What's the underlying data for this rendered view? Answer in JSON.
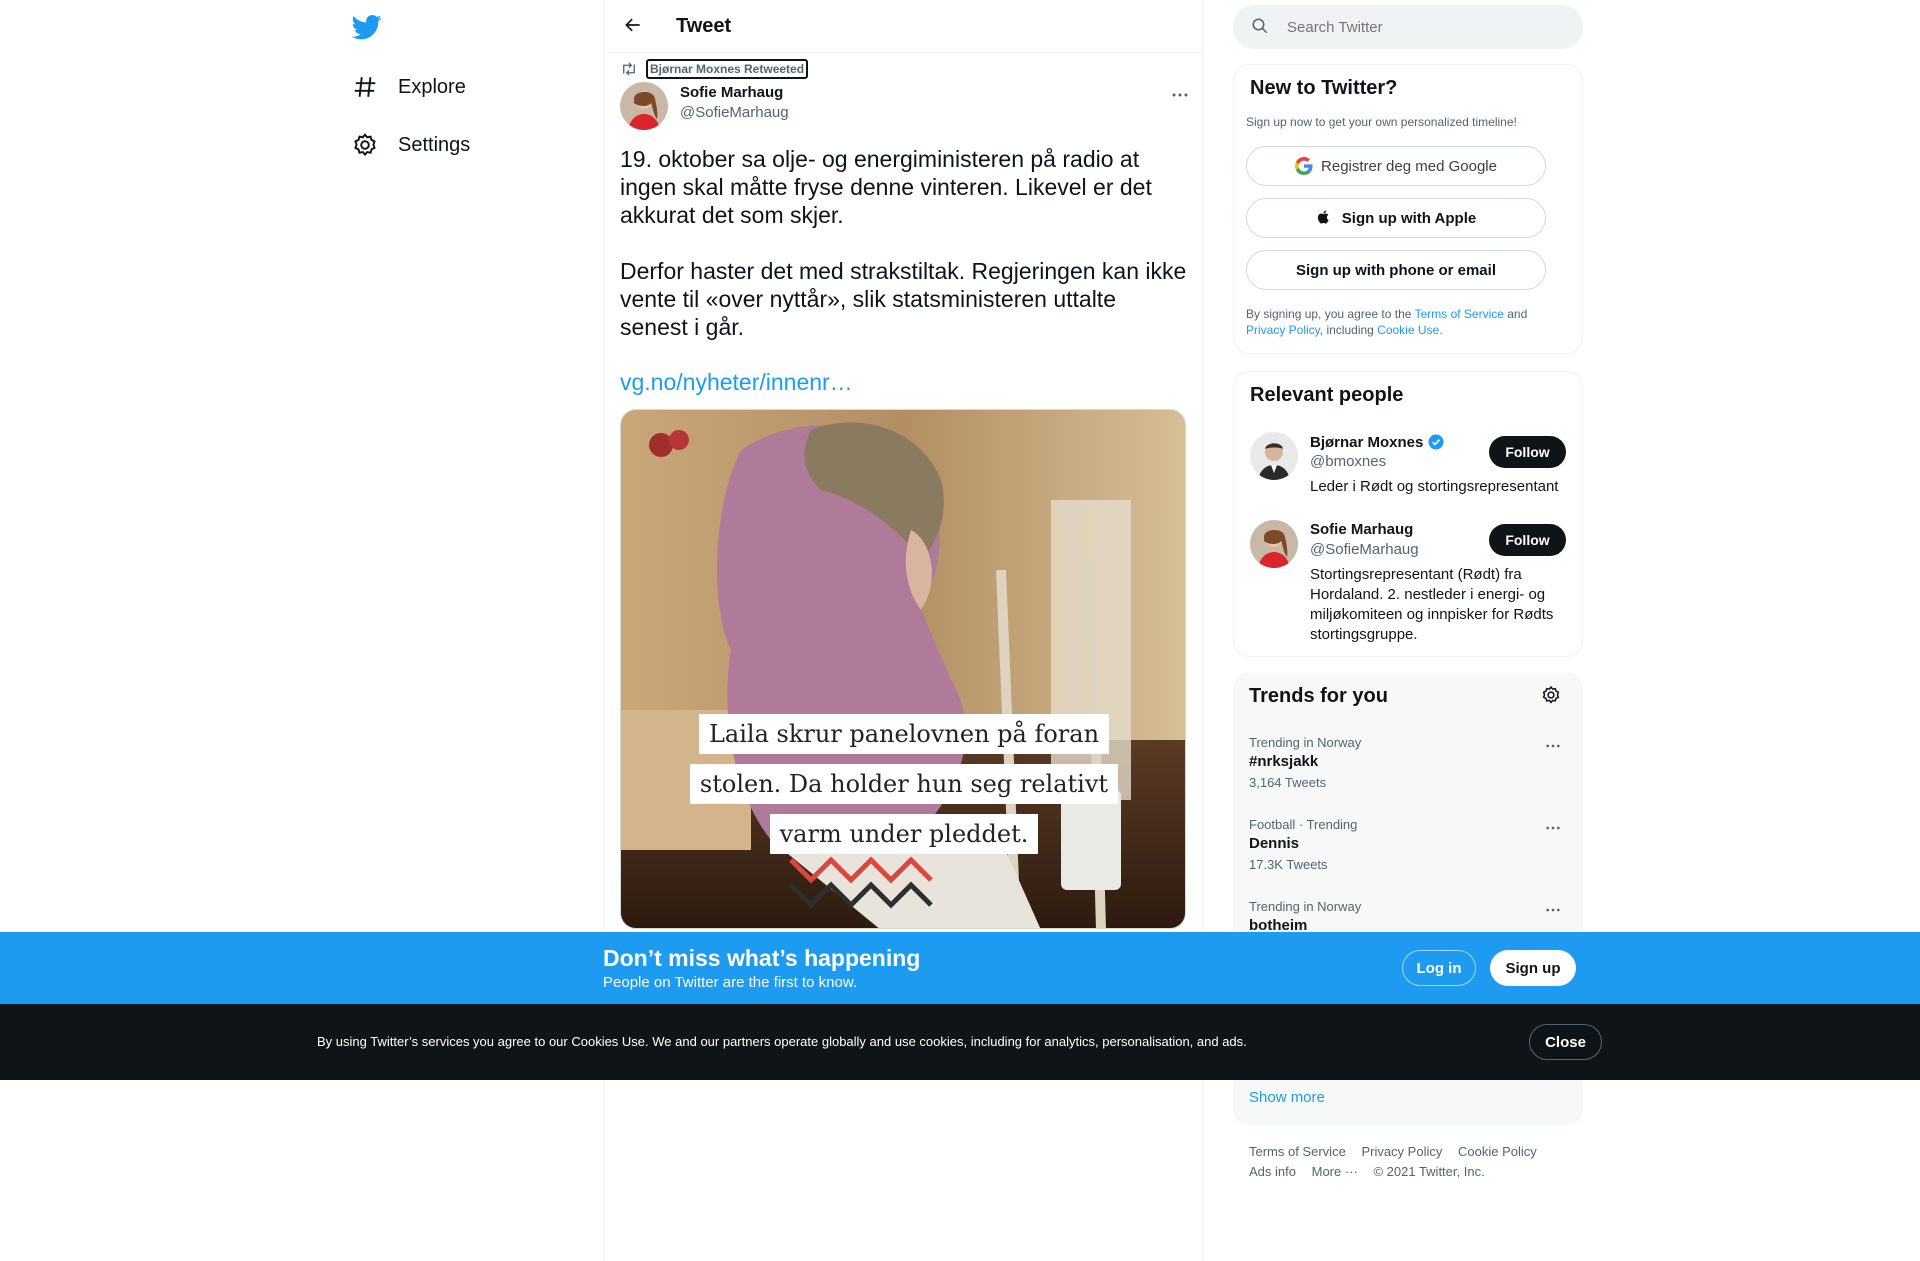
{
  "colors": {
    "accent": "#1d9bf0",
    "text": "#0f1419",
    "muted": "#536471",
    "border": "#eff3f4"
  },
  "nav": {
    "logo_icon": "twitter-bird-icon",
    "items": [
      {
        "label": "Explore",
        "icon": "hashtag-icon"
      },
      {
        "label": "Settings",
        "icon": "gear-icon"
      }
    ]
  },
  "header": {
    "title": "Tweet",
    "back_icon": "arrow-left-icon"
  },
  "tweet": {
    "retweeted_by": "Bjørnar Moxnes Retweeted",
    "author_name": "Sofie Marhaug",
    "author_handle": "@SofieMarhaug",
    "paragraphs": [
      "19. oktober sa olje- og energiministeren på radio at ingen skal måtte fryse denne vinteren. Likevel er det akkurat det som skjer.",
      "Derfor haster det med strakstiltak. Regjeringen kan ikke vente til «over nyttår», slik statsministeren uttalte senest i går."
    ],
    "link": "vg.no/nyheter/innenr…",
    "media_caption": "Laila skrur panelovnen på foran stolen. Da holder hun seg relativt varm under pleddet."
  },
  "search": {
    "placeholder": "Search Twitter"
  },
  "new_to_twitter": {
    "title": "New to Twitter?",
    "subtitle": "Sign up now to get your own personalized timeline!",
    "google_label": "Registrer deg med Google",
    "apple_label": "Sign up with Apple",
    "phone_label": "Sign up with phone or email",
    "legal_prefix": "By signing up, you agree to the ",
    "terms": "Terms of Service",
    "and": " and ",
    "privacy": "Privacy Policy",
    "including": ", including ",
    "cookie": "Cookie Use."
  },
  "relevant_people": {
    "title": "Relevant people",
    "people": [
      {
        "name": "Bjørnar Moxnes",
        "handle": "@bmoxnes",
        "bio": "Leder i Rødt og stortingsrepresentant",
        "verified": true,
        "follow_label": "Follow"
      },
      {
        "name": "Sofie Marhaug",
        "handle": "@SofieMarhaug",
        "bio": "Stortingsrepresentant (Rødt) fra Hordaland. 2. nestleder i energi- og miljøkomiteen og innpisker for Rødts stortingsgruppe.",
        "verified": false,
        "follow_label": "Follow"
      }
    ]
  },
  "trends": {
    "title": "Trends for you",
    "items": [
      {
        "meta": "Trending in Norway",
        "name": "#nrksjakk",
        "count": "3,164 Tweets"
      },
      {
        "meta": "Football · Trending",
        "name": "Dennis",
        "count": "17.3K Tweets"
      },
      {
        "meta": "Trending in Norway",
        "name": "botheim",
        "count": ""
      }
    ],
    "show_more": "Show more"
  },
  "footer": {
    "links": [
      "Terms of Service",
      "Privacy Policy",
      "Cookie Policy",
      "Ads info",
      "More ···"
    ],
    "copyright": "© 2021 Twitter, Inc."
  },
  "bottom_bar": {
    "title": "Don’t miss what’s happening",
    "subtitle": "People on Twitter are the first to know.",
    "login": "Log in",
    "signup": "Sign up"
  },
  "cookie_bar": {
    "text": "By using Twitter’s services you agree to our Cookies Use. We and our partners operate globally and use cookies, including for analytics, personalisation, and ads.",
    "close": "Close"
  }
}
